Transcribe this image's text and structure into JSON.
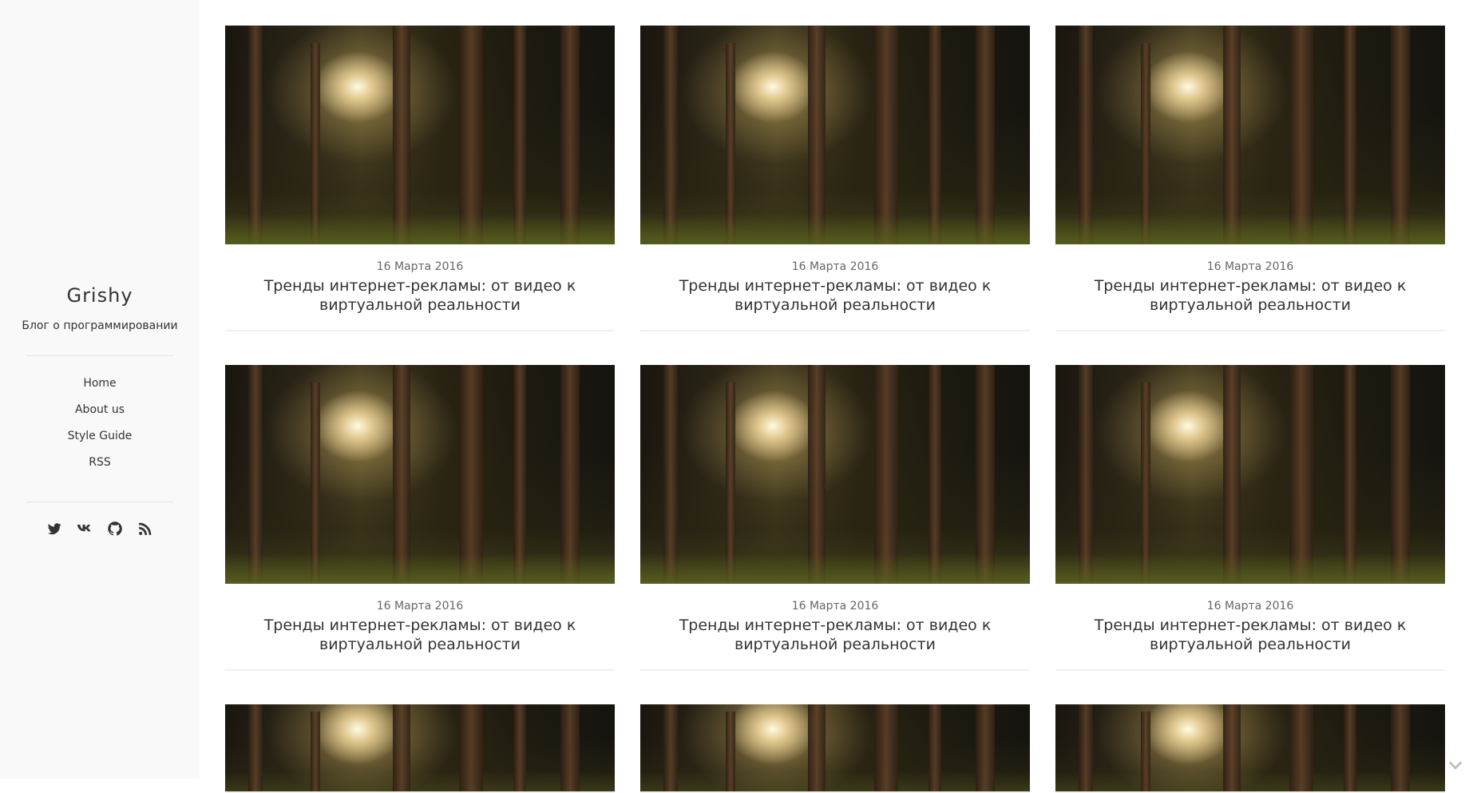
{
  "sidebar": {
    "title": "Grishy",
    "tagline": "Блог о программировании",
    "nav": [
      {
        "label": "Home"
      },
      {
        "label": "About us"
      },
      {
        "label": "Style Guide"
      },
      {
        "label": "RSS"
      }
    ],
    "social": [
      {
        "icon": "twitter-icon"
      },
      {
        "icon": "vk-icon"
      },
      {
        "icon": "github-icon"
      },
      {
        "icon": "rss-icon"
      }
    ]
  },
  "posts": [
    {
      "date": "16 Марта 2016",
      "title": "Тренды интернет-рекламы: от видео к виртуальной реальности"
    },
    {
      "date": "16 Марта 2016",
      "title": "Тренды интернет-рекламы: от видео к виртуальной реальности"
    },
    {
      "date": "16 Марта 2016",
      "title": "Тренды интернет-рекламы: от видео к виртуальной реальности"
    },
    {
      "date": "16 Марта 2016",
      "title": "Тренды интернет-рекламы: от видео к виртуальной реальности"
    },
    {
      "date": "16 Марта 2016",
      "title": "Тренды интернет-рекламы: от видео к виртуальной реальности"
    },
    {
      "date": "16 Марта 2016",
      "title": "Тренды интернет-рекламы: от видео к виртуальной реальности"
    },
    {
      "date": "",
      "title": ""
    },
    {
      "date": "",
      "title": ""
    },
    {
      "date": "",
      "title": ""
    }
  ]
}
